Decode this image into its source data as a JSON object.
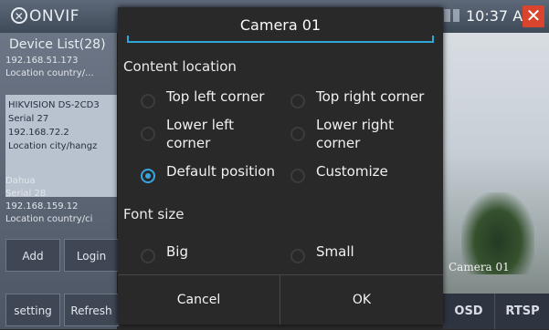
{
  "app": {
    "title": "ONVIF",
    "time": "10:37 AM",
    "close_glyph": "✕"
  },
  "device_list": {
    "title": "Device List(28)",
    "devices": [
      {
        "lines": [
          "192.168.51.173",
          "Location country/..."
        ]
      },
      {
        "lines": [
          "HIKVISION DS-2CD3",
          "Serial 27",
          "192.168.72.2",
          "Location city/hangz"
        ]
      },
      {
        "lines": [
          "Dahua",
          "Serial 28",
          "192.168.159.12",
          "Location country/ci"
        ]
      }
    ],
    "buttons": {
      "add": "Add",
      "login": "Login",
      "setting": "setting",
      "refresh": "Refresh"
    }
  },
  "preview": {
    "overlay_label": "Camera 01",
    "osd": "OSD",
    "rtsp": "RTSP"
  },
  "dialog": {
    "name_value": "Camera 01",
    "content_location_title": "Content location",
    "options": {
      "top_left": "Top left corner",
      "top_right": "Top right corner",
      "lower_left": "Lower left\ncorner",
      "lower_right": "Lower right\ncorner",
      "default": "Default position",
      "customize": "Customize"
    },
    "selected_location": "default",
    "font_size_title": "Font size",
    "font_options": {
      "big": "Big",
      "small": "Small"
    },
    "selected_font_size": null,
    "cancel": "Cancel",
    "ok": "OK"
  },
  "colors": {
    "accent": "#37a6e0",
    "dialog_bg": "#292929",
    "close_red": "#d9442e"
  }
}
